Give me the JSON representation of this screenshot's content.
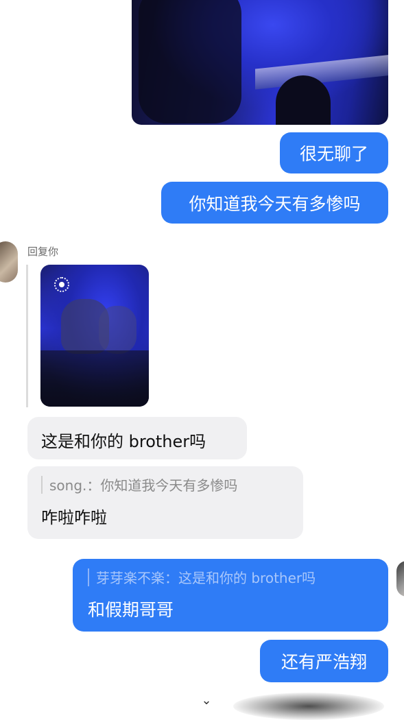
{
  "messages": {
    "m1": "很无聊了",
    "m2": "你知道我今天有多惨吗",
    "reply_label": "回复你",
    "m3": "这是和你的 brother吗",
    "m4_quote": "song.：你知道我今天有多惨吗",
    "m4_text": "咋啦咋啦",
    "m5_quote": "芽芽楽不楽：这是和你的 brother吗",
    "m5_text": "和假期哥哥",
    "m6": "还有严浩翔"
  },
  "icons": {
    "live_photo": "live-photo-icon",
    "scroll_down": "double-chevron-down-icon"
  },
  "colors": {
    "outgoing_bubble": "#2f7cf6",
    "incoming_bubble": "#f0f0f2"
  }
}
